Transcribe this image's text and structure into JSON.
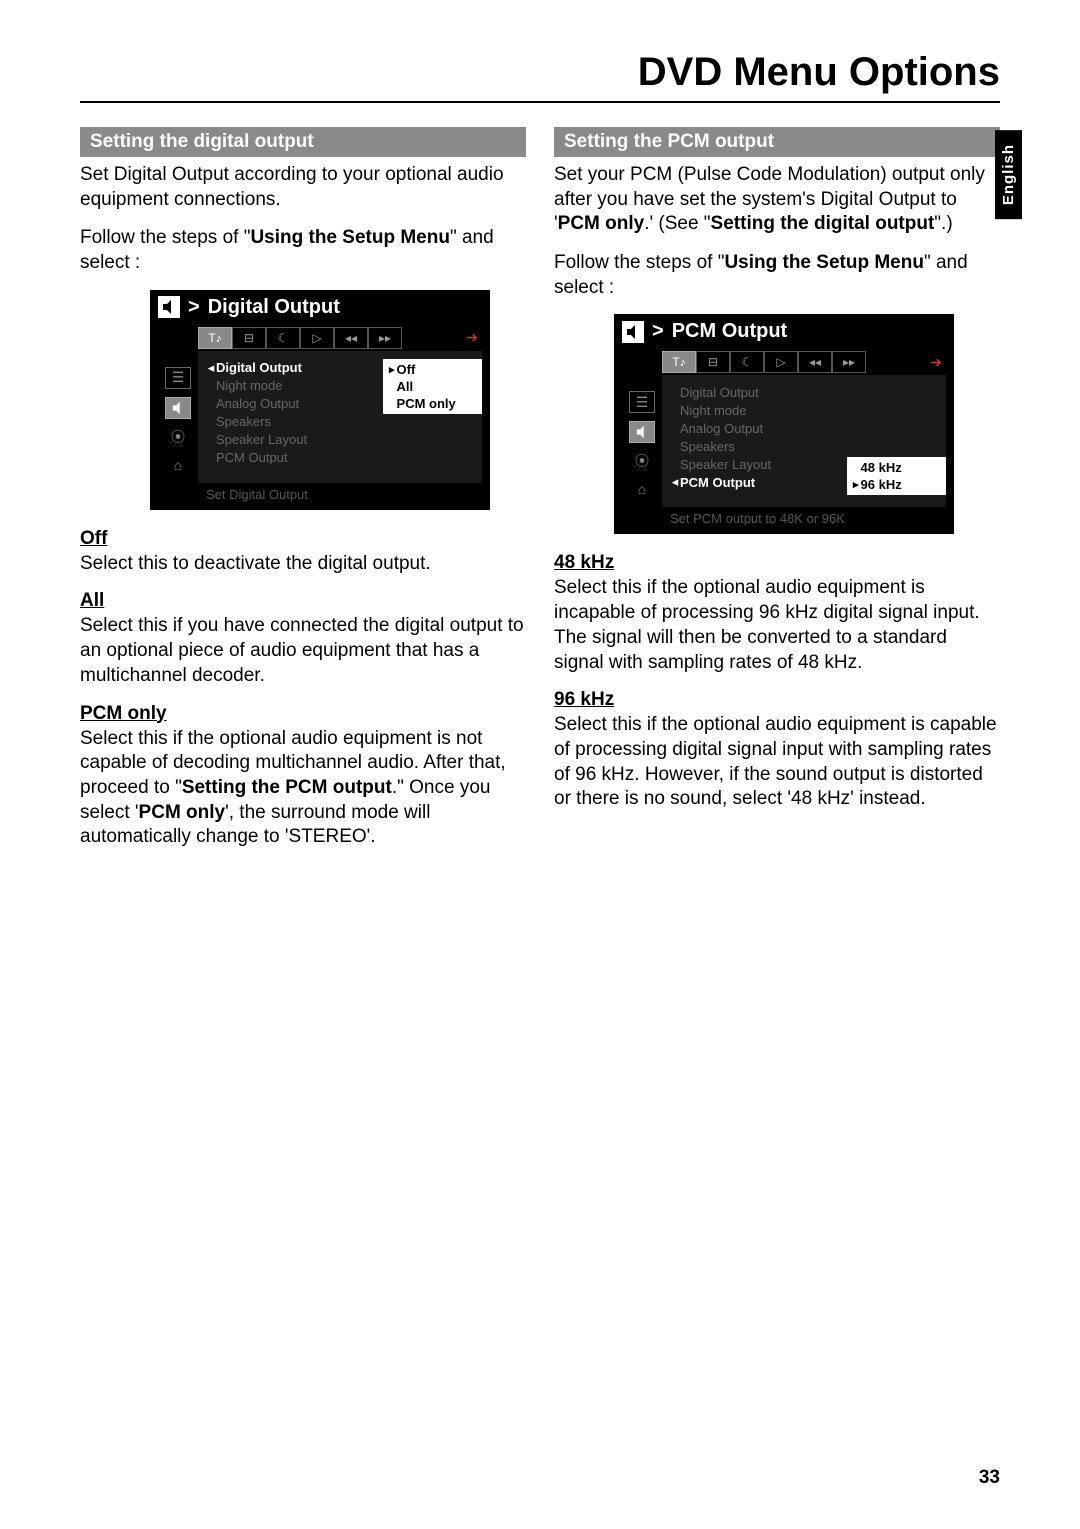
{
  "pageTitle": "DVD Menu Options",
  "langTab": "English",
  "pageNumber": "33",
  "left": {
    "sectionBar": "Setting the digital output",
    "intro": "Set Digital Output according to your optional audio equipment connections.",
    "follow1": "Follow the steps of \"",
    "followBold": "Using the Setup Menu",
    "follow2": "\" and select :",
    "osd": {
      "title": "Digital Output",
      "menu": [
        "Digital Output",
        "Night mode",
        "Analog Output",
        "Speakers",
        "Speaker Layout",
        "PCM Output"
      ],
      "activeIndex": 0,
      "options": [
        "Off",
        "All",
        "PCM only"
      ],
      "helper": "Set Digital Output"
    },
    "off": {
      "head": "Off",
      "body": "Select this to deactivate the digital output."
    },
    "all": {
      "head": "All",
      "body": "Select this if you have connected the digital output to an optional piece of audio equipment that has a multichannel decoder."
    },
    "pcm": {
      "head": "PCM only",
      "p1a": "Select this if the optional audio equipment is not capable of decoding multichannel audio.  After that, proceed to \"",
      "p1b": "Setting the PCM output",
      "p1c": ".\" Once you select '",
      "p1d": "PCM only",
      "p1e": "', the surround mode will automatically change to 'STEREO'."
    }
  },
  "right": {
    "sectionBar": "Setting the PCM output",
    "p1a": "Set your PCM (Pulse Code Modulation) output only after you have set the system's Digital Output to '",
    "p1b": "PCM only",
    "p1c": ".'  (See \"",
    "p1d": "Setting the digital output",
    "p1e": "\".)",
    "follow1": "Follow the steps of \"",
    "followBold": "Using the Setup Menu",
    "follow2": "\" and select :",
    "osd": {
      "title": "PCM Output",
      "menu": [
        "Digital Output",
        "Night mode",
        "Analog Output",
        "Speakers",
        "Speaker Layout",
        "PCM Output"
      ],
      "activeIndex": 5,
      "options": [
        "48 kHz",
        "96 kHz"
      ],
      "helper": "Set PCM output to 48K or 96K"
    },
    "k48": {
      "head": "48 kHz",
      "body": "Select this if the optional audio equipment is incapable of processing 96 kHz digital signal input.  The signal will then be converted to a standard signal with sampling rates of 48 kHz."
    },
    "k96": {
      "head": "96 kHz",
      "body": "Select this if the optional audio equipment is capable of processing digital signal input with sampling rates of 96 kHz.  However, if the sound output is distorted or there is no sound, select '48 kHz' instead."
    }
  }
}
